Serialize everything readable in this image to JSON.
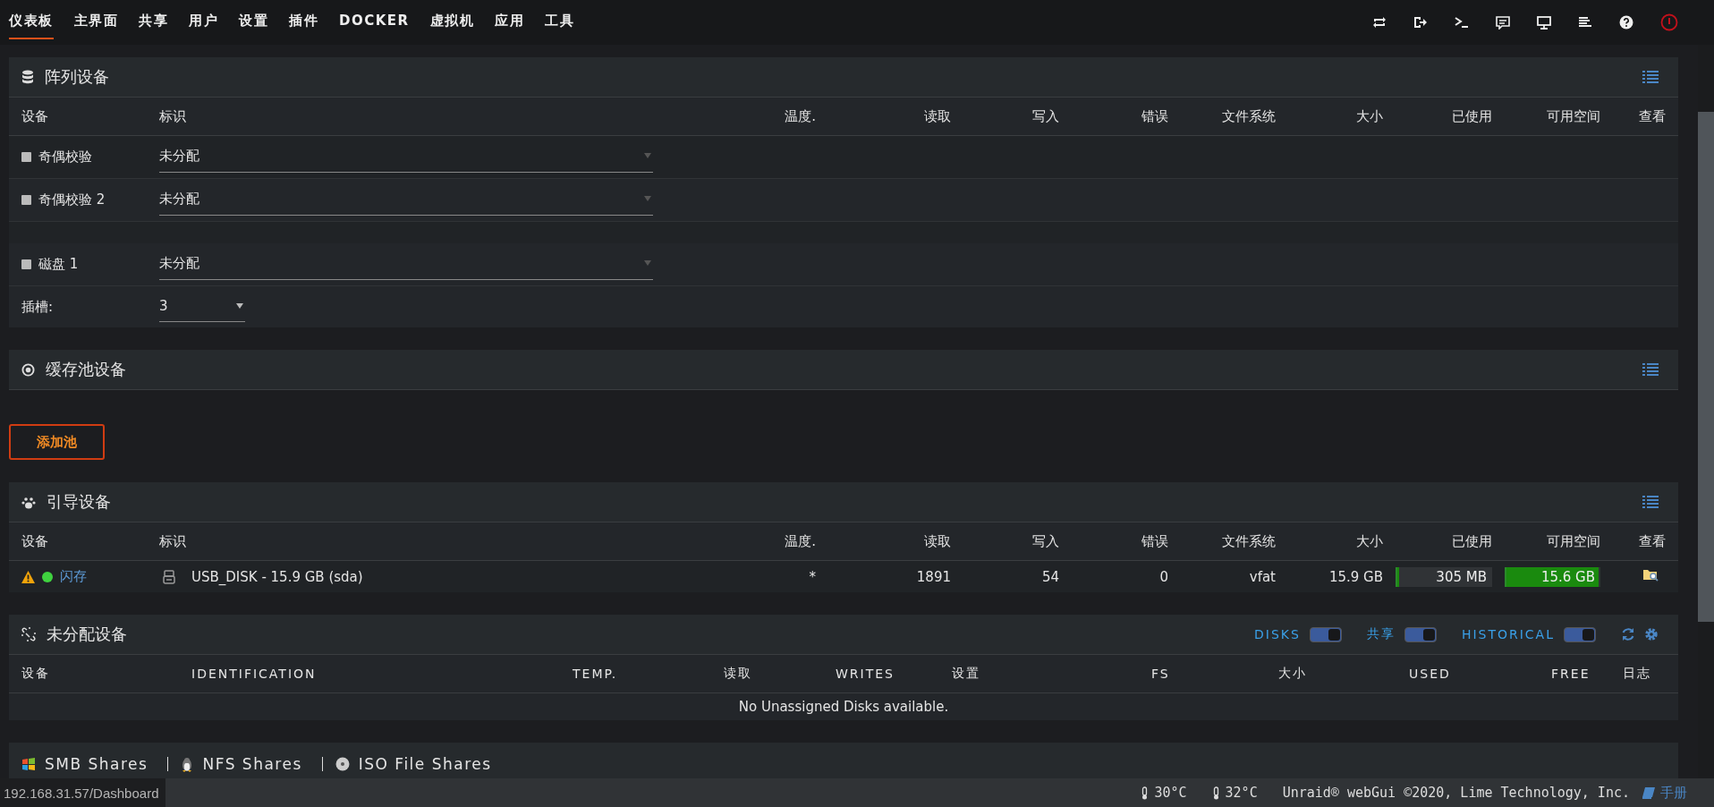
{
  "nav": {
    "tabs": [
      {
        "label": "仪表板",
        "selected": true
      },
      {
        "label": "主界面",
        "selected": false
      },
      {
        "label": "共享",
        "selected": false
      },
      {
        "label": "用户",
        "selected": false
      },
      {
        "label": "设置",
        "selected": false
      },
      {
        "label": "插件",
        "selected": false
      },
      {
        "label": "DOCKER",
        "selected": false
      },
      {
        "label": "虚拟机",
        "selected": false
      },
      {
        "label": "应用",
        "selected": false
      },
      {
        "label": "工具",
        "selected": false
      }
    ]
  },
  "array": {
    "title": "阵列设备",
    "columns": [
      "设备",
      "标识",
      "温度.",
      "读取",
      "写入",
      "错误",
      "文件系统",
      "大小",
      "已使用",
      "可用空间",
      "查看"
    ],
    "rows": [
      {
        "kind": "device",
        "name": "奇偶校验",
        "value": "未分配"
      },
      {
        "kind": "device",
        "name": "奇偶校验 2",
        "value": "未分配"
      },
      {
        "kind": "spacer"
      },
      {
        "kind": "device",
        "name": "磁盘 1",
        "value": "未分配"
      },
      {
        "kind": "slots",
        "name": "插槽:",
        "value": "3"
      }
    ]
  },
  "cache": {
    "title": "缓存池设备",
    "add_button": "添加池"
  },
  "boot": {
    "title": "引导设备",
    "columns": [
      "设备",
      "标识",
      "温度.",
      "读取",
      "写入",
      "错误",
      "文件系统",
      "大小",
      "已使用",
      "可用空间",
      "查看"
    ],
    "row": {
      "name": "闪存",
      "identification": "USB_DISK - 15.9 GB (sda)",
      "temp": "*",
      "reads": "1891",
      "writes": "54",
      "errors": "0",
      "fs": "vfat",
      "size": "15.9 GB",
      "used": {
        "text": "305 MB",
        "level": 0.02
      },
      "free": {
        "text": "15.6 GB",
        "level": 0.98
      }
    }
  },
  "unassigned": {
    "title": "未分配设备",
    "toggles": [
      {
        "label": "DISKS",
        "on": true
      },
      {
        "label": "共享",
        "on": true
      },
      {
        "label": "HISTORICAL",
        "on": true
      }
    ],
    "columns": [
      "设备",
      "IDENTIFICATION",
      "TEMP.",
      "读取",
      "WRITES",
      "设置",
      "FS",
      "大小",
      "USED",
      "FREE",
      "日志"
    ],
    "message": "No Unassigned Disks available."
  },
  "shares": [
    "SMB Shares",
    "NFS Shares",
    "ISO File Shares"
  ],
  "status_bar": {
    "url": "192.168.31.57/Dashboard",
    "temps": [
      "30°C",
      "32°C"
    ],
    "copyright": "Unraid® webGui ©2020, Lime Technology, Inc.",
    "manual": "手册"
  }
}
